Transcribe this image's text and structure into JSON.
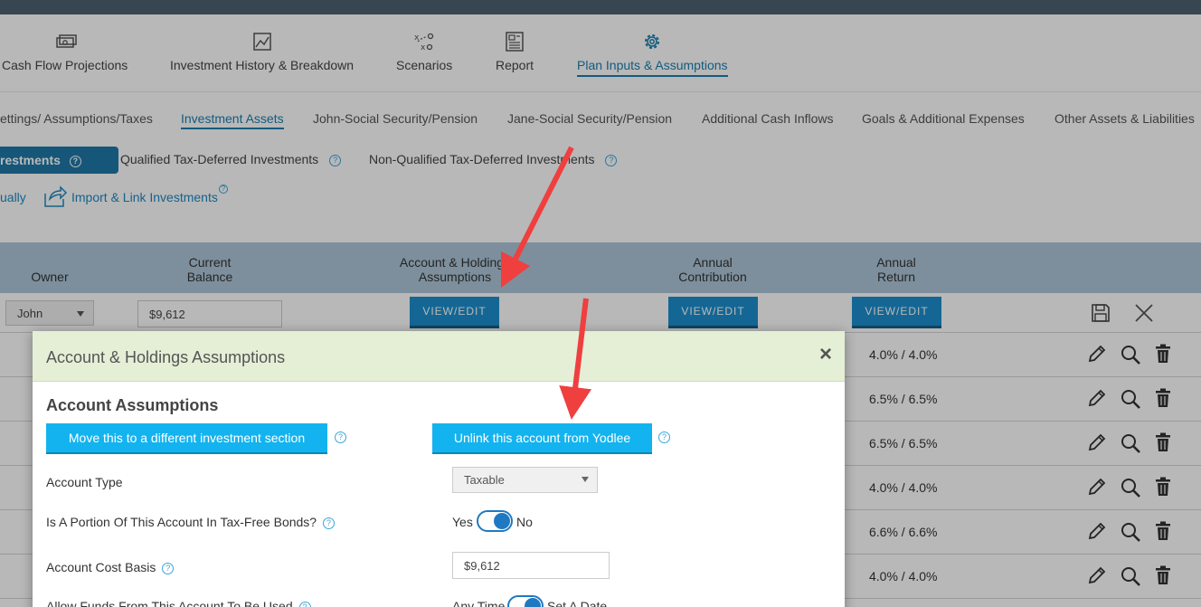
{
  "main_nav": [
    {
      "label": "Cash Flow Projections",
      "icon": "cash-icon"
    },
    {
      "label": "Investment History & Breakdown",
      "icon": "chart-icon"
    },
    {
      "label": "Scenarios",
      "icon": "strategy-icon"
    },
    {
      "label": "Report",
      "icon": "report-icon"
    },
    {
      "label": "Plan Inputs & Assumptions",
      "icon": "gear-icon",
      "active": true
    }
  ],
  "sub_nav": [
    {
      "label": "ettings/ Assumptions/Taxes"
    },
    {
      "label": "Investment Assets",
      "active": true
    },
    {
      "label": "John-Social Security/Pension"
    },
    {
      "label": "Jane-Social Security/Pension"
    },
    {
      "label": "Additional Cash Inflows"
    },
    {
      "label": "Goals & Additional Expenses"
    },
    {
      "label": "Other Assets & Liabilities"
    }
  ],
  "investment_tabs": {
    "active_label": "restments",
    "qualified": "Qualified Tax-Deferred Investments",
    "non_qualified": "Non-Qualified Tax-Deferred Investments",
    "help_glyph": "?"
  },
  "links": {
    "manually": "ually",
    "import": "Import & Link Investments"
  },
  "table": {
    "headers": {
      "owner": "Owner",
      "current_balance": "Current Balance",
      "account_holdings": "Account & Holdings Assumptions",
      "annual_contribution": "Annual Contribution",
      "annual_return": "Annual Return"
    },
    "edit_row": {
      "owner": "John",
      "balance": "$9,612",
      "view_edit": "VIEW/EDIT"
    },
    "returns": [
      "4.0% / 4.0%",
      "6.5% / 6.5%",
      "6.5% / 6.5%",
      "4.0% / 4.0%",
      "6.6% / 6.6%",
      "4.0% / 4.0%"
    ]
  },
  "modal": {
    "title": "Account & Holdings Assumptions",
    "close": "×",
    "section_title": "Account Assumptions",
    "move_button": "Move this to a different investment section",
    "unlink_button": "Unlink this account from Yodlee",
    "account_type_label": "Account Type",
    "account_type_value": "Taxable",
    "tax_free_label": "Is A Portion Of This Account In Tax-Free Bonds?",
    "yes": "Yes",
    "no": "No",
    "cost_basis_label": "Account Cost Basis",
    "cost_basis_value": "$9,612",
    "allow_funds_label": "Allow Funds From This Account To Be Used",
    "any_time": "Any Time",
    "set_date": "Set A Date"
  },
  "colors": {
    "accent": "#1d8fce",
    "arrow": "#ef3f3f",
    "header_bg": "#aec6d8",
    "modal_header": "#e4efd6"
  }
}
